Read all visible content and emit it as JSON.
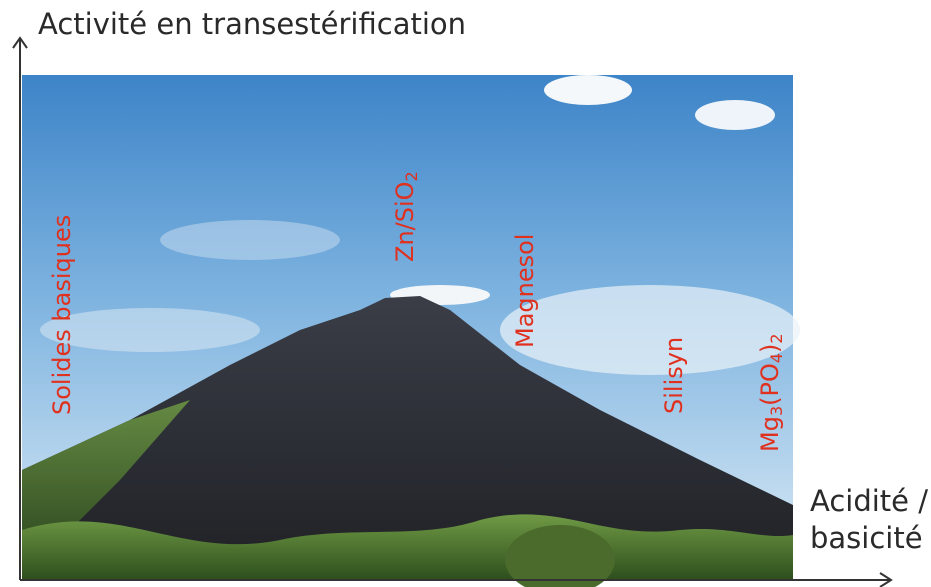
{
  "y_axis": {
    "title": "Activité en transestérification"
  },
  "x_axis": {
    "title_line1": "Acidité /",
    "title_line2": "basicité"
  },
  "labels": {
    "solides_basiques": "Solides basiques",
    "zn_a": "Zn/SiO",
    "zn_b": "2",
    "magnesol": "Magnesol",
    "silisyn": "Silisyn",
    "mg_a": "Mg",
    "mg_b": "3",
    "mg_c": "(PO",
    "mg_d": "4",
    "mg_e": ")",
    "mg_f": "2"
  },
  "colors": {
    "label": "#e0301e",
    "axis": "#333333",
    "sky_top": "#3f86c9",
    "sky_bottom": "#cfe3f3",
    "mountain": "#2a2c33",
    "vegetation": "#4f7a32"
  }
}
